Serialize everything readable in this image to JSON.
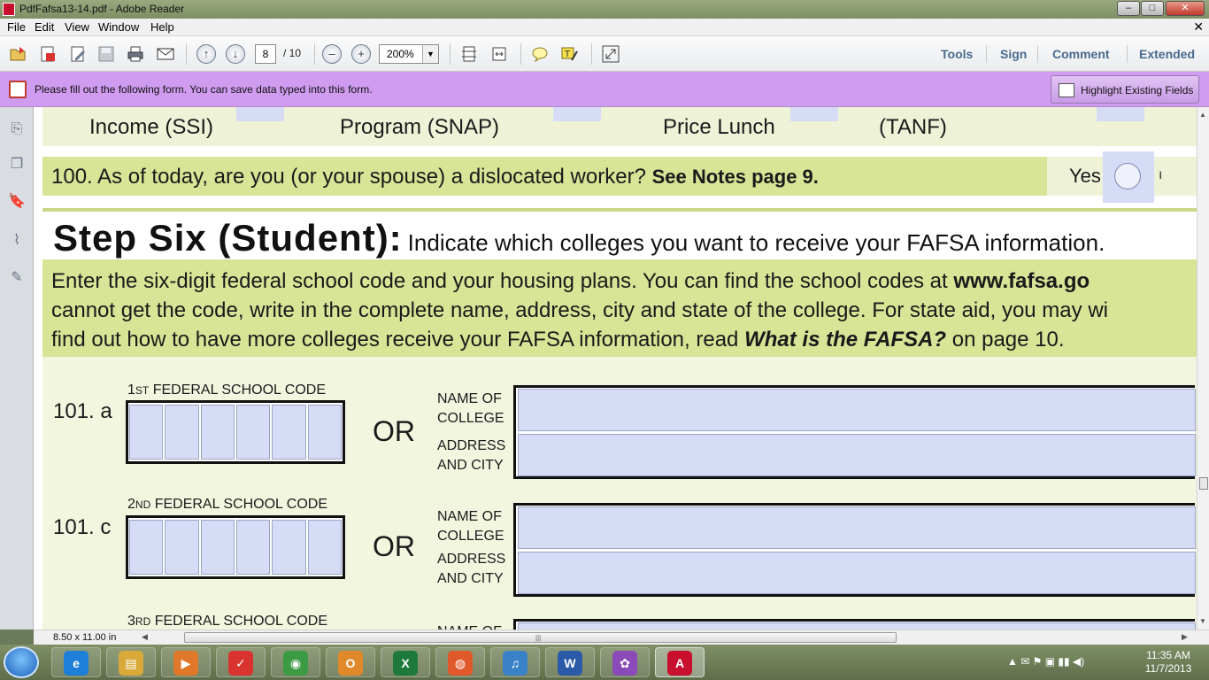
{
  "window": {
    "title": "PdfFafsa13-14.pdf - Adobe Reader",
    "min_label": "–",
    "max_label": "□",
    "close_label": "✕"
  },
  "menu": {
    "items": [
      "File",
      "Edit",
      "View",
      "Window",
      "Help"
    ],
    "doc_close": "✕"
  },
  "toolbar": {
    "current_page": "8",
    "total_pages": "/ 10",
    "zoom": "200%",
    "zoom_dropdown": "▼",
    "zoom_out": "–",
    "zoom_in": "+",
    "prev_page": "↑",
    "next_page": "↓",
    "panels": [
      "Tools",
      "Sign",
      "Comment",
      "Extended"
    ]
  },
  "notification": {
    "text": "Please fill out the following form. You can save data typed into this form.",
    "highlight_button": "Highlight Existing Fields"
  },
  "document": {
    "benefits_row": [
      "Income (SSI)",
      "Program (SNAP)",
      "Price Lunch",
      "(TANF)"
    ],
    "q100": {
      "text": "100. As of today, are you (or your spouse) a dislocated worker?",
      "bold": "See Notes page 9.",
      "yes_label": "Yes",
      "cut_text": "ı"
    },
    "step_title": {
      "heading": "Step Six (Student):",
      "subheading": "Indicate which colleges you want to receive your FAFSA information."
    },
    "instructions": {
      "line1_a": "Enter the six-digit federal school code and your housing plans. You can find the school codes at ",
      "line1_b": "www.fafsa.go",
      "line2": "cannot get the code, write in the complete name, address, city and state of the college. For state aid, you may wi",
      "line3_a": "find out how to have more colleges receive your FAFSA information, read ",
      "line3_b": "What is the FAFSA?",
      "line3_c": " on page 10."
    },
    "school1": {
      "num": "101. a",
      "label_ord": "1",
      "label_sup": "ST",
      "label_rest": " FEDERAL SCHOOL CODE",
      "or": "OR",
      "name_lbl1": "NAME OF",
      "name_lbl2": "COLLEGE",
      "addr_lbl1": "ADDRESS",
      "addr_lbl2": "AND CITY"
    },
    "school2": {
      "num": "101. c",
      "label_ord": "2",
      "label_sup": "ND",
      "label_rest": " FEDERAL SCHOOL CODE",
      "or": "OR",
      "name_lbl1": "NAME OF",
      "name_lbl2": "COLLEGE",
      "addr_lbl1": "ADDRESS",
      "addr_lbl2": "AND CITY"
    },
    "school3": {
      "label_ord": "3",
      "label_sup": "RD",
      "label_rest": " FEDERAL SCHOOL CODE",
      "name_lbl1": "NAME OF"
    }
  },
  "status": {
    "page_size": "8.50 x 11.00 in",
    "grip": "|||"
  },
  "taskbar": {
    "apps": [
      {
        "name": "internet-explorer",
        "glyph": "e",
        "color": "#1e7fd8"
      },
      {
        "name": "file-explorer",
        "glyph": "▤",
        "color": "#d9a93a"
      },
      {
        "name": "media-player",
        "glyph": "▶",
        "color": "#e0782a"
      },
      {
        "name": "todoist",
        "glyph": "✓",
        "color": "#d9332f"
      },
      {
        "name": "chrome",
        "glyph": "◉",
        "color": "#3c9a44"
      },
      {
        "name": "outlook",
        "glyph": "O",
        "color": "#e0892a"
      },
      {
        "name": "excel",
        "glyph": "X",
        "color": "#1e7a3c"
      },
      {
        "name": "firefox",
        "glyph": "◍",
        "color": "#e0592a"
      },
      {
        "name": "itunes",
        "glyph": "♫",
        "color": "#3a82c8"
      },
      {
        "name": "word",
        "glyph": "W",
        "color": "#2a5aa8"
      },
      {
        "name": "picasa",
        "glyph": "✿",
        "color": "#8a4ab8"
      },
      {
        "name": "adobe-reader",
        "glyph": "A",
        "color": "#c8102e"
      }
    ],
    "tray_icons": "▲  ✉  ⚑  ▣  ▮▮  ◀)",
    "time": "11:35 AM",
    "date": "11/7/2013"
  }
}
